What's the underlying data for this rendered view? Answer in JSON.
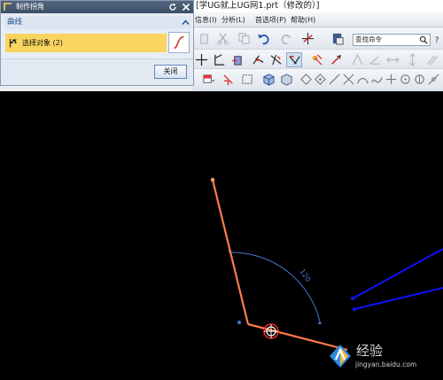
{
  "window": {
    "title": "[学UG就上UG网1.prt（修改的）]"
  },
  "menu": {
    "items": [
      "信息(I)",
      "分析(L)",
      "首选项(P)",
      "帮助(H)"
    ]
  },
  "toolbar": {
    "search_placeholder": "查找命令"
  },
  "dialog": {
    "title": "制作拐角",
    "group_title": "曲线",
    "select_label": "选择对象 (2)",
    "close_button_label": "关闭"
  },
  "graphics": {
    "angle_annotation": "120",
    "colors": {
      "background": "#000000",
      "selected_curve": "#ff7a4a",
      "existing_curve": "#1010ff",
      "arc_indicator": "#4a78d8",
      "pick_circle": "#ff2020"
    }
  },
  "watermark": {
    "brand_text": "经验",
    "domain": "jingyan.baidu.com"
  }
}
